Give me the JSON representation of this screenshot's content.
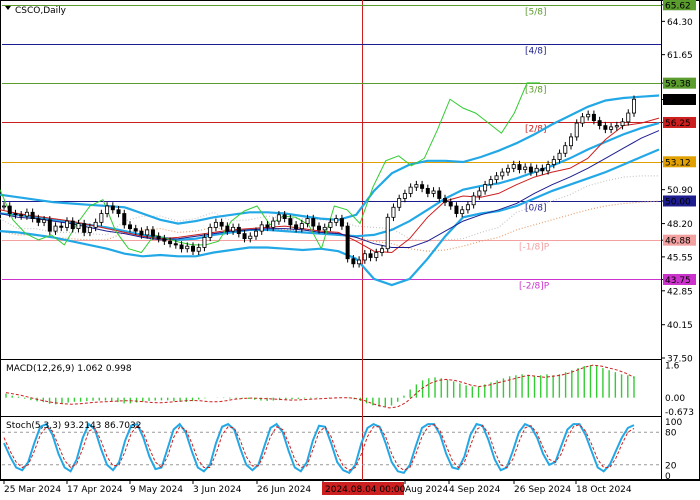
{
  "chart_data": [
    {
      "type": "candlestick",
      "title": "CSCO,Daily",
      "ylim": [
        37.5,
        66.0
      ],
      "x_ticks": [
        "25 Mar 2024",
        "17 Apr 2024",
        "9 May 2024",
        "3 Jun 2024",
        "26 Jun 2024",
        "2024.08.04 00:00",
        "Aug 2024",
        "4 Sep 2024",
        "26 Sep 2024",
        "18 Oct 2024"
      ],
      "y_ticks": [
        "65.62",
        "64.30",
        "61.65",
        "59.38",
        "58.08",
        "56.25",
        "53.12",
        "50.90",
        "50.00",
        "48.20",
        "46.88",
        "45.55",
        "43.75",
        "42.85",
        "40.15",
        "37.50"
      ],
      "cursor_label": "2024.08.04 00:00",
      "murrey_levels": [
        {
          "label": "[5/8]",
          "value": 65.62,
          "color": "#5a9c2d"
        },
        {
          "label": "[4/8]",
          "value": 62.5,
          "color": "#1d1d8f"
        },
        {
          "label": "[3/8]",
          "value": 59.38,
          "color": "#5a9c2d"
        },
        {
          "label": "[2/8]",
          "value": 56.25,
          "color": "#cc1f1f"
        },
        {
          "label": "",
          "value": 53.12,
          "color": "#e0a000"
        },
        {
          "label": "[0/8]",
          "value": 50.0,
          "color": "#1d1d8f"
        },
        {
          "label": "[-1/8]P",
          "value": 46.88,
          "color": "#f2a0a0"
        },
        {
          "label": "[-2/8]P",
          "value": 43.75,
          "color": "#cc33cc"
        }
      ],
      "last_price": "58.08",
      "close_series": [
        49.6,
        49.0,
        48.9,
        48.8,
        49.1,
        48.6,
        48.3,
        48.5,
        47.6,
        48.0,
        47.9,
        48.4,
        47.8,
        48.2,
        47.5,
        47.9,
        48.3,
        49.0,
        49.6,
        49.3,
        49.0,
        48.1,
        47.8,
        47.6,
        47.3,
        47.7,
        47.2,
        47.0,
        46.8,
        46.6,
        46.5,
        46.2,
        46.4,
        46.0,
        46.3,
        47.1,
        47.9,
        48.3,
        48.0,
        47.6,
        47.9,
        47.4,
        47.0,
        47.2,
        47.6,
        48.1,
        47.9,
        48.4,
        48.9,
        48.6,
        48.1,
        47.8,
        48.2,
        48.6,
        48.0,
        47.7,
        47.9,
        48.3,
        48.6,
        48.0,
        45.4,
        45.0,
        45.3,
        45.8,
        45.5,
        45.9,
        46.2,
        48.7,
        49.5,
        50.2,
        50.6,
        51.1,
        51.3,
        51.0,
        50.6,
        50.8,
        50.2,
        49.9,
        49.6,
        49.0,
        49.3,
        49.7,
        50.4,
        50.8,
        51.3,
        51.7,
        52.0,
        52.3,
        52.6,
        52.9,
        52.5,
        52.7,
        52.3,
        52.6,
        52.4,
        52.9,
        53.3,
        53.8,
        54.4,
        55.1,
        56.2,
        56.7,
        56.9,
        56.4,
        56.0,
        55.7,
        55.9,
        56.0,
        56.3,
        57.0,
        58.1
      ],
      "bollinger": {
        "middle": [
          49.0,
          48.9,
          48.7,
          48.5,
          48.3,
          48.1,
          47.9,
          47.6,
          47.3,
          47.1,
          46.9,
          47.0,
          47.3,
          47.5,
          47.7,
          47.7,
          47.6,
          47.5,
          47.4,
          47.3,
          47.2,
          47.3,
          47.7,
          48.4,
          49.3,
          50.2,
          50.9,
          51.2,
          51.4,
          51.8,
          52.3,
          52.8,
          53.4,
          54.1,
          54.7,
          55.3,
          55.8,
          56.2
        ],
        "upper": [
          50.5,
          50.3,
          50.1,
          49.9,
          49.8,
          49.7,
          49.6,
          49.5,
          49.0,
          48.5,
          48.2,
          48.4,
          48.7,
          48.9,
          49.1,
          49.1,
          49.0,
          48.8,
          48.6,
          48.5,
          48.9,
          50.8,
          52.2,
          52.9,
          53.2,
          53.2,
          53.1,
          53.5,
          54.0,
          54.6,
          55.3,
          56.1,
          56.8,
          57.5,
          58.0,
          58.2,
          58.3,
          58.4
        ],
        "lower": [
          47.6,
          47.5,
          47.3,
          47.1,
          46.8,
          46.5,
          46.2,
          45.8,
          45.6,
          45.7,
          45.6,
          45.6,
          45.9,
          46.1,
          46.3,
          46.3,
          46.2,
          46.1,
          46.2,
          46.0,
          45.4,
          43.8,
          43.3,
          43.8,
          45.4,
          47.2,
          48.7,
          49.0,
          49.2,
          49.6,
          50.2,
          50.8,
          51.3,
          51.8,
          52.3,
          52.9,
          53.5,
          54.1
        ]
      },
      "envelope_upper": [
        48.6,
        47.8,
        47.8,
        47.5,
        47.5,
        47.4,
        47.3,
        48.4,
        48.8,
        48.8,
        48.4,
        48.6,
        49.1,
        48.4,
        48.5,
        48.8,
        48.6,
        48.6,
        48.5,
        48.4,
        48.0,
        47.9,
        47.8,
        47.0,
        46.8,
        46.9,
        47.0,
        47.5,
        47.9,
        49.1,
        49.6,
        50.0,
        50.5,
        51.2,
        51.6,
        51.9,
        52.0,
        52.0
      ],
      "envelope_lower": [
        47.6,
        47.3,
        47.3,
        47.1,
        47.0,
        46.9,
        46.9,
        47.5,
        47.7,
        47.8,
        47.5,
        47.6,
        47.9,
        47.6,
        47.7,
        47.9,
        47.7,
        47.7,
        47.6,
        47.4,
        47.1,
        46.8,
        46.6,
        46.2,
        46.0,
        46.1,
        46.4,
        46.8,
        47.1,
        47.7,
        48.1,
        48.5,
        48.9,
        49.3,
        49.6,
        49.8,
        49.9,
        50.0
      ],
      "lagging_line": [
        50.9,
        48.5,
        47.4,
        46.9,
        47.3,
        46.5,
        48.2,
        49.6,
        50.1,
        47.6,
        46.2,
        45.9,
        47.3,
        47.0,
        46.7,
        46.5,
        46.5,
        46.8,
        48.4,
        49.2,
        49.6,
        48.1,
        48.8,
        48.7,
        48.1,
        46.2,
        49.6,
        49.3,
        48.2,
        51.1,
        53.2,
        53.6,
        52.8,
        53.4,
        55.6,
        58.1,
        57.4,
        57.0,
        56.2,
        55.4,
        57.0,
        59.4,
        59.4
      ],
      "red_line": [
        49.3,
        49.0,
        48.8,
        48.6,
        48.4,
        48.1,
        47.8,
        47.5,
        47.2,
        47.0,
        47.1,
        47.3,
        47.5,
        47.7,
        47.8,
        47.9,
        48.0,
        47.8,
        47.6,
        47.5,
        46.8,
        46.0,
        45.9,
        47.0,
        48.7,
        50.0,
        50.4,
        50.3,
        50.6,
        51.3,
        51.9,
        52.3,
        52.6,
        53.4,
        54.9,
        56.0,
        56.2,
        56.6
      ],
      "blue_line": [
        49.0,
        48.7,
        48.6,
        48.4,
        48.2,
        47.9,
        47.6,
        47.4,
        47.1,
        46.9,
        47.0,
        47.2,
        47.4,
        47.6,
        47.7,
        47.8,
        47.8,
        47.7,
        47.5,
        47.4,
        47.1,
        46.6,
        46.3,
        46.3,
        46.8,
        47.6,
        48.4,
        48.9,
        49.3,
        49.8,
        50.6,
        51.3,
        51.9,
        52.6,
        53.4,
        54.2,
        55.0,
        55.6
      ]
    },
    {
      "type": "bar",
      "title": "MACD(12,26,9) 1.062 0.998",
      "y_ticks": [
        "1.6",
        "0.00",
        "-0.673"
      ],
      "ylim": [
        -0.85,
        1.85
      ],
      "histogram": [
        0.2,
        0.1,
        0.05,
        -0.05,
        -0.12,
        -0.18,
        -0.22,
        -0.3,
        -0.33,
        -0.3,
        -0.24,
        -0.2,
        -0.2,
        -0.17,
        -0.15,
        -0.14,
        -0.14,
        -0.17,
        -0.22,
        -0.28,
        -0.28,
        -0.24,
        -0.2,
        -0.16,
        -0.14,
        -0.13,
        -0.13,
        -0.17,
        -0.2,
        -0.21,
        -0.17,
        -0.09,
        -0.03,
        0.0,
        -0.01,
        -0.02,
        -0.04,
        -0.05,
        -0.04,
        -0.06,
        -0.1,
        -0.14,
        -0.16,
        -0.14,
        -0.12,
        -0.1,
        -0.08,
        -0.06,
        -0.04,
        -0.03,
        -0.02,
        0.0,
        0.02,
        0.02,
        0.0,
        -0.02,
        -0.08,
        -0.16,
        -0.28,
        -0.38,
        -0.44,
        -0.45,
        -0.38,
        -0.2,
        0.1,
        0.4,
        0.65,
        0.85,
        0.95,
        1.0,
        0.95,
        0.88,
        0.8,
        0.7,
        0.6,
        0.55,
        0.55,
        0.65,
        0.75,
        0.85,
        0.95,
        1.05,
        1.1,
        1.15,
        1.1,
        1.05,
        1.1,
        1.15,
        1.1,
        1.15,
        1.25,
        1.35,
        1.45,
        1.55,
        1.6,
        1.55,
        1.45,
        1.35,
        1.25,
        1.15,
        1.1,
        1.05
      ],
      "signal": [
        0.25,
        0.18,
        0.1,
        0.0,
        -0.1,
        -0.18,
        -0.25,
        -0.3,
        -0.32,
        -0.3,
        -0.26,
        -0.22,
        -0.2,
        -0.18,
        -0.16,
        -0.15,
        -0.17,
        -0.2,
        -0.24,
        -0.25,
        -0.22,
        -0.18,
        -0.15,
        -0.14,
        -0.16,
        -0.2,
        -0.2,
        -0.15,
        -0.08,
        -0.04,
        -0.02,
        -0.03,
        -0.05,
        -0.07,
        -0.1,
        -0.12,
        -0.11,
        -0.08,
        -0.06,
        -0.04,
        -0.02,
        0.0,
        0.0,
        -0.05,
        -0.15,
        -0.3,
        -0.42,
        -0.5,
        -0.45,
        -0.25,
        0.1,
        0.45,
        0.7,
        0.85,
        0.9,
        0.85,
        0.75,
        0.62,
        0.55,
        0.6,
        0.7,
        0.8,
        0.9,
        1.0,
        1.1,
        1.05,
        1.0,
        1.05,
        1.1,
        1.2,
        1.35,
        1.5,
        1.6,
        1.55,
        1.45,
        1.35,
        1.2,
        1.0
      ]
    },
    {
      "type": "line",
      "title": "Stoch(5,3,3) 93.2143 86.7032",
      "y_ticks": [
        "100",
        "80",
        "20",
        "0"
      ],
      "ylim": [
        -8,
        108
      ],
      "k": [
        60,
        35,
        15,
        10,
        25,
        60,
        90,
        95,
        75,
        40,
        15,
        8,
        30,
        70,
        95,
        85,
        50,
        20,
        10,
        25,
        65,
        92,
        95,
        70,
        35,
        12,
        15,
        50,
        85,
        95,
        80,
        45,
        15,
        8,
        20,
        60,
        90,
        95,
        85,
        50,
        20,
        10,
        20,
        55,
        88,
        95,
        80,
        45,
        15,
        8,
        25,
        65,
        92,
        90,
        60,
        25,
        10,
        5,
        20,
        60,
        88,
        95,
        90,
        60,
        25,
        8,
        5,
        20,
        55,
        88,
        95,
        95,
        75,
        40,
        15,
        12,
        35,
        75,
        95,
        92,
        65,
        30,
        10,
        15,
        45,
        80,
        95,
        90,
        70,
        40,
        20,
        25,
        55,
        85,
        95,
        95,
        75,
        45,
        15,
        8,
        20,
        45,
        70,
        88,
        93
      ],
      "d": [
        70,
        45,
        25,
        15,
        20,
        45,
        75,
        90,
        82,
        55,
        28,
        15,
        22,
        50,
        82,
        88,
        65,
        35,
        18,
        20,
        45,
        78,
        92,
        80,
        50,
        25,
        15,
        35,
        70,
        90,
        85,
        60,
        30,
        15,
        15,
        40,
        75,
        90,
        88,
        65,
        35,
        18,
        18,
        40,
        72,
        90,
        85,
        60,
        30,
        15,
        18,
        48,
        80,
        90,
        72,
        40,
        18,
        10,
        15,
        40,
        72,
        90,
        90,
        72,
        40,
        18,
        10,
        15,
        40,
        72,
        90,
        94,
        82,
        55,
        28,
        15,
        25,
        55,
        85,
        92,
        78,
        45,
        20,
        15,
        30,
        62,
        88,
        92,
        78,
        52,
        30,
        25,
        40,
        70,
        90,
        94,
        82,
        58,
        30,
        15,
        15,
        32,
        58,
        80,
        87
      ]
    }
  ]
}
